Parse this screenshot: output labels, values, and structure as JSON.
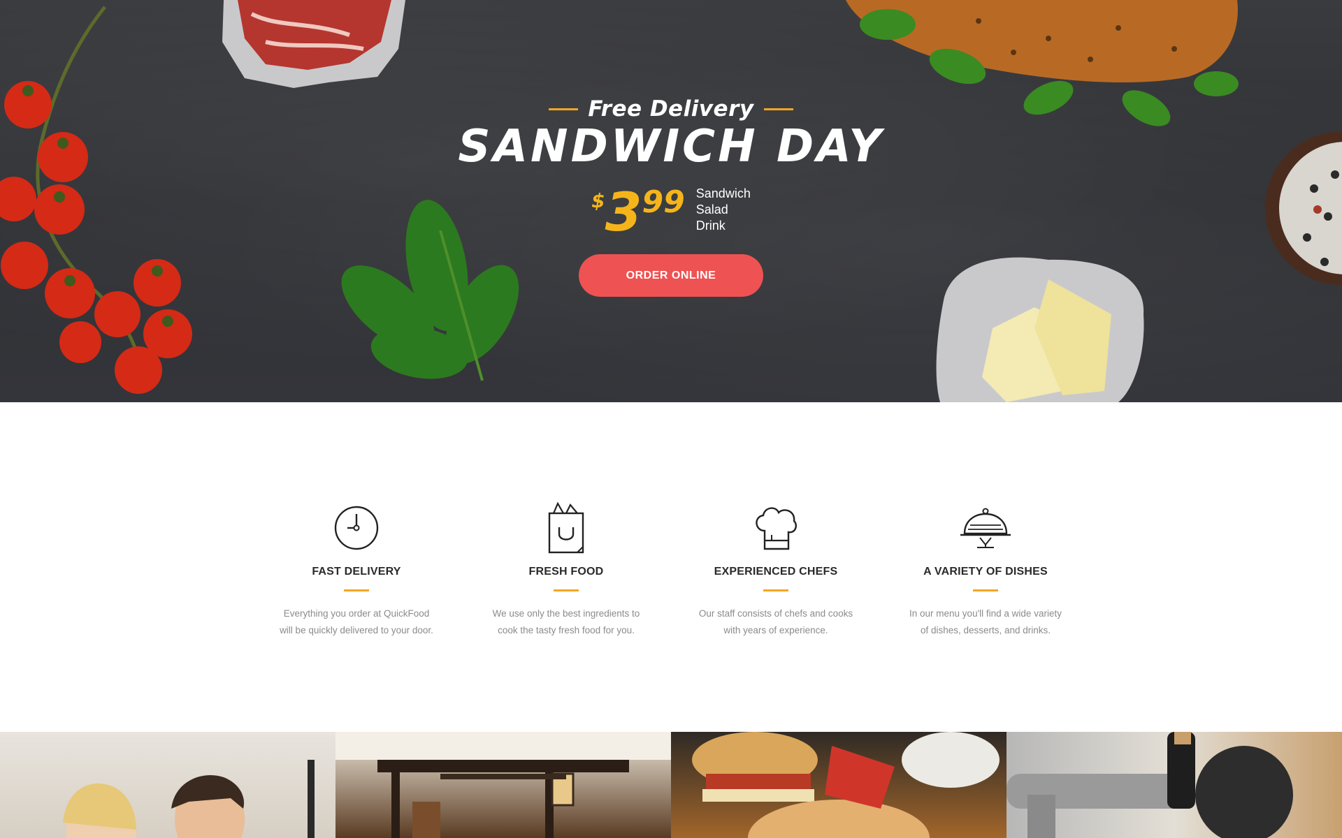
{
  "hero": {
    "kicker": "Free Delivery",
    "headline": "SANDWICH DAY",
    "price": {
      "currency": "$",
      "main": "3",
      "cents": "99"
    },
    "includes": [
      "Sandwich",
      "Salad",
      "Drink"
    ],
    "cta_label": "ORDER ONLINE",
    "colors": {
      "accent": "#f5a623",
      "price": "#f5b51a",
      "cta": "#ee5252",
      "background": "#333438"
    }
  },
  "features": [
    {
      "icon": "clock-icon",
      "title": "FAST DELIVERY",
      "desc_line1": "Everything you order at QuickFood",
      "desc_line2": "will be quickly delivered to your door."
    },
    {
      "icon": "grocery-bag-icon",
      "title": "FRESH FOOD",
      "desc_line1": "We use only the best ingredients to",
      "desc_line2": "cook the tasty fresh food for you."
    },
    {
      "icon": "chef-hat-icon",
      "title": "EXPERIENCED CHEFS",
      "desc_line1": "Our staff consists of chefs and cooks",
      "desc_line2": "with years of experience."
    },
    {
      "icon": "cloche-icon",
      "title": "A VARIETY OF DISHES",
      "desc_line1": "In our menu you'll find a wide variety",
      "desc_line2": "of dishes, desserts, and drinks."
    }
  ],
  "gallery": [
    "photo-chefs",
    "photo-restaurant-interior",
    "photo-burger",
    "photo-beer-tap"
  ]
}
